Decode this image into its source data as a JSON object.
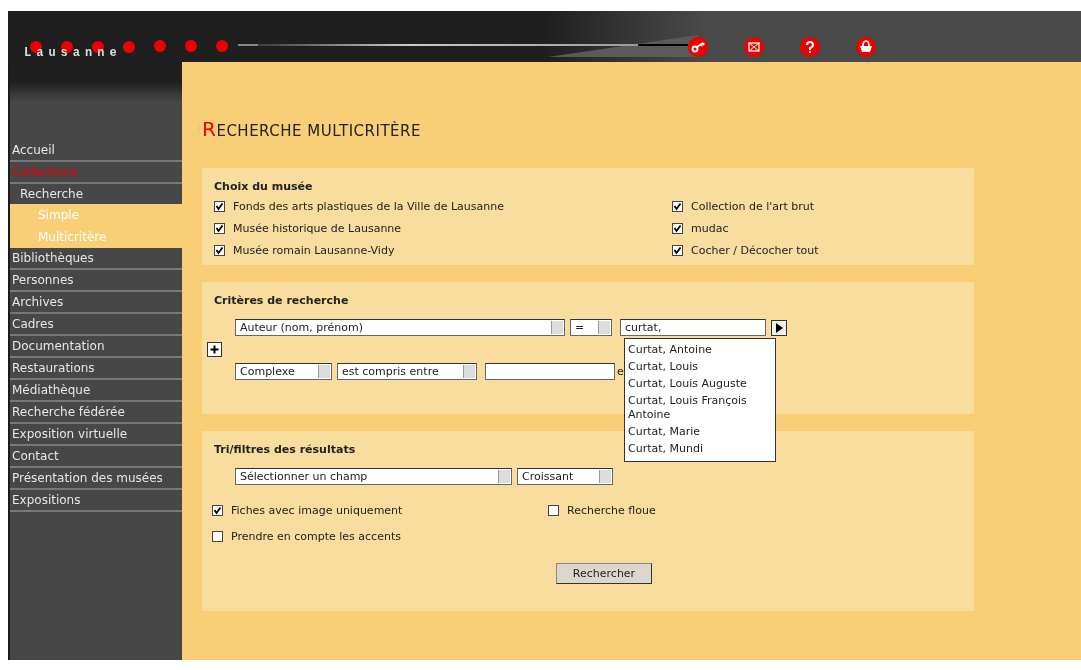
{
  "header": {
    "logo": "Lausanne",
    "icons": [
      {
        "kind": "key"
      },
      {
        "kind": "mail"
      },
      {
        "kind": "help"
      },
      {
        "kind": "basket"
      }
    ]
  },
  "sidebar": {
    "items": [
      {
        "label": "Accueil",
        "kind": "item",
        "selected": false
      },
      {
        "label": "Collections",
        "kind": "item",
        "selected": true
      },
      {
        "label": "Recherche",
        "kind": "sub",
        "selected": false
      },
      {
        "label": "Simple",
        "kind": "subsub",
        "selected": false
      },
      {
        "label": "Multicritère",
        "kind": "subsub",
        "selected": false
      },
      {
        "label": "Bibliothèques",
        "kind": "item",
        "selected": false
      },
      {
        "label": "Personnes",
        "kind": "item",
        "selected": false
      },
      {
        "label": "Archives",
        "kind": "item",
        "selected": false
      },
      {
        "label": "Cadres",
        "kind": "item",
        "selected": false
      },
      {
        "label": "Documentation",
        "kind": "item",
        "selected": false
      },
      {
        "label": "Restaurations",
        "kind": "item",
        "selected": false
      },
      {
        "label": "Médiathèque",
        "kind": "item",
        "selected": false
      },
      {
        "label": "Recherche fédérée",
        "kind": "item",
        "selected": false
      },
      {
        "label": "Exposition virtuelle",
        "kind": "item",
        "selected": false
      },
      {
        "label": "Contact",
        "kind": "item",
        "selected": false
      },
      {
        "label": "Présentation des musées",
        "kind": "item",
        "selected": false
      },
      {
        "label": "Expositions",
        "kind": "item",
        "selected": false
      }
    ]
  },
  "page_title": "RECHERCHE MULTICRITÈRE",
  "museums": {
    "title": "Choix du musée",
    "left": [
      {
        "label": "Fonds des arts plastiques de la Ville de Lausanne",
        "checked": true
      },
      {
        "label": "Musée historique de Lausanne",
        "checked": true
      },
      {
        "label": "Musée romain Lausanne-Vidy",
        "checked": true
      }
    ],
    "right": [
      {
        "label": "Collection de l'art brut",
        "checked": true
      },
      {
        "label": "mudac",
        "checked": true
      },
      {
        "label": "Cocher / Décocher tout",
        "checked": true
      }
    ]
  },
  "criteria": {
    "title": "Critères de recherche",
    "field": "Auteur (nom, prénom)",
    "operator": "=",
    "value": "curtat,",
    "suggestions": [
      "Curtat, Antoine",
      "Curtat, Louis",
      "Curtat, Louis Auguste",
      "Curtat, Louis François Antoine",
      "Curtat, Marie",
      "Curtat, Mundi"
    ],
    "field_2": "Complexe",
    "operator_2": "est compris entre",
    "connector": "e"
  },
  "sorting": {
    "title": "Tri/filtres des résultats",
    "field": "Sélectionner un champ",
    "order": "Croissant",
    "options": [
      {
        "label": "Fiches avec image uniquement",
        "checked": true
      },
      {
        "label": "Recherche floue",
        "checked": false
      },
      {
        "label": "Prendre en compte les accents",
        "checked": false
      }
    ],
    "button": "Rechercher"
  }
}
